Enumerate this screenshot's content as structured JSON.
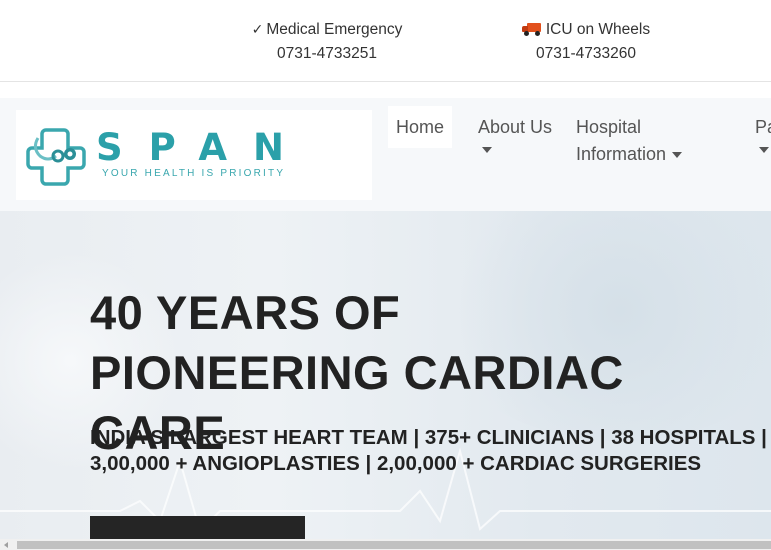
{
  "topbar": {
    "emergency": {
      "check_glyph": "✓",
      "label": "Medical Emergency",
      "phone": "0731-4733251"
    },
    "icu": {
      "icon": "ambulance-truck-icon",
      "label": "ICU on Wheels",
      "phone": "0731-4733260"
    }
  },
  "logo": {
    "name": "SPAN",
    "tagline": "YOUR HEALTH IS PRIORITY",
    "color": "#2ba0a9"
  },
  "nav": {
    "home": "Home",
    "about": "About Us",
    "hospital_line1": "Hospital",
    "hospital_line2": "Information",
    "partial": "Pa"
  },
  "hero": {
    "title_line1": "40 YEARS OF",
    "title_line2": "PIONEERING CARDIAC CARE",
    "sub_line1": "INDIA’S LARGEST HEART TEAM | 375+ CLINICIANS | 38 HOSPITALS |",
    "sub_line2": "3,00,000 + ANGIOPLASTIES | 2,00,000 + CARDIAC SURGERIES"
  }
}
